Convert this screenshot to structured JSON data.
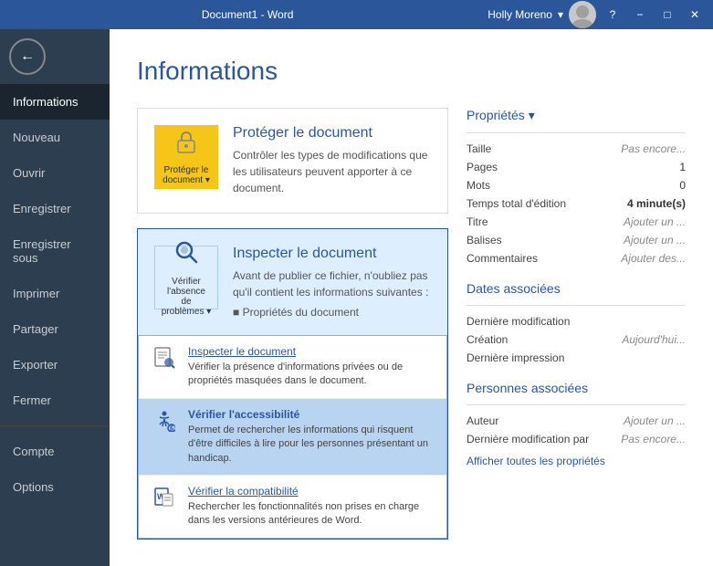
{
  "titlebar": {
    "title": "Document1 - Word",
    "help": "?",
    "minimize": "−",
    "restore": "□",
    "close": "✕"
  },
  "user": {
    "name": "Holly Moreno",
    "dropdown": "▾"
  },
  "sidebar": {
    "back_label": "←",
    "items": [
      {
        "id": "informations",
        "label": "Informations",
        "active": true
      },
      {
        "id": "nouveau",
        "label": "Nouveau",
        "active": false
      },
      {
        "id": "ouvrir",
        "label": "Ouvrir",
        "active": false
      },
      {
        "id": "enregistrer",
        "label": "Enregistrer",
        "active": false
      },
      {
        "id": "enregistrer-sous",
        "label": "Enregistrer sous",
        "active": false
      },
      {
        "id": "imprimer",
        "label": "Imprimer",
        "active": false
      },
      {
        "id": "partager",
        "label": "Partager",
        "active": false
      },
      {
        "id": "exporter",
        "label": "Exporter",
        "active": false
      },
      {
        "id": "fermer",
        "label": "Fermer",
        "active": false
      },
      {
        "id": "compte",
        "label": "Compte",
        "active": false
      },
      {
        "id": "options",
        "label": "Options",
        "active": false
      }
    ]
  },
  "main": {
    "title": "Informations",
    "protect_card": {
      "icon_symbol": "🔒",
      "icon_label": "Protéger le\ndocument ▾",
      "title": "Protéger le document",
      "desc": "Contrôler les types de modifications que les utilisateurs peuvent apporter à ce document."
    },
    "inspect_card": {
      "icon_symbol": "🔍",
      "icon_label": "Vérifier l'absence\nde problèmes ▾",
      "title": "Inspecter le document",
      "desc": "Avant de publier ce fichier, n'oubliez pas qu'il contient les informations suivantes :",
      "bullet": "■  Propriétés du document"
    },
    "dropdown_items": [
      {
        "id": "inspecter",
        "icon": "📄",
        "title": "Inspecter le document",
        "desc": "Vérifier la présence d'informations privées ou de propriétés masquées dans le document.",
        "highlighted": false
      },
      {
        "id": "accessibilite",
        "icon": "♿",
        "title": "Vérifier l'accessibilité",
        "desc": "Permet de rechercher les informations qui risquent d'être difficiles à lire pour les personnes présentant un handicap.",
        "highlighted": true
      },
      {
        "id": "compatibilite",
        "icon": "📝",
        "title": "Vérifier la compatibilité",
        "desc": "Rechercher les fonctionnalités non prises en charge dans les versions antérieures de Word.",
        "highlighted": false
      }
    ]
  },
  "properties": {
    "section_title": "Propriétés ▾",
    "rows": [
      {
        "label": "Taille",
        "value": "Pas encore...",
        "style": "gray"
      },
      {
        "label": "Pages",
        "value": "1",
        "style": "normal"
      },
      {
        "label": "Mots",
        "value": "0",
        "style": "normal"
      },
      {
        "label": "Temps total d'édition",
        "value": "4 minute(s)",
        "style": "bold"
      },
      {
        "label": "Titre",
        "value": "Ajouter un ...",
        "style": "gray"
      },
      {
        "label": "Balises",
        "value": "Ajouter un ...",
        "style": "gray"
      },
      {
        "label": "Commentaires",
        "value": "Ajouter des...",
        "style": "gray"
      }
    ],
    "dates_title": "Dates associées",
    "dates": [
      {
        "label": "Dernière modification",
        "value": "",
        "style": "gray"
      },
      {
        "label": "Création",
        "value": "Aujourd'hui...",
        "style": "gray"
      },
      {
        "label": "Dernière impression",
        "value": "",
        "style": "gray"
      }
    ],
    "persons_title": "Personnes associées",
    "persons": [
      {
        "label": "Auteur",
        "value": "Ajouter un ...",
        "style": "gray"
      },
      {
        "label": "Dernière modification par",
        "value": "Pas encore...",
        "style": "gray"
      }
    ],
    "all_props_link": "Afficher toutes les propriétés"
  }
}
